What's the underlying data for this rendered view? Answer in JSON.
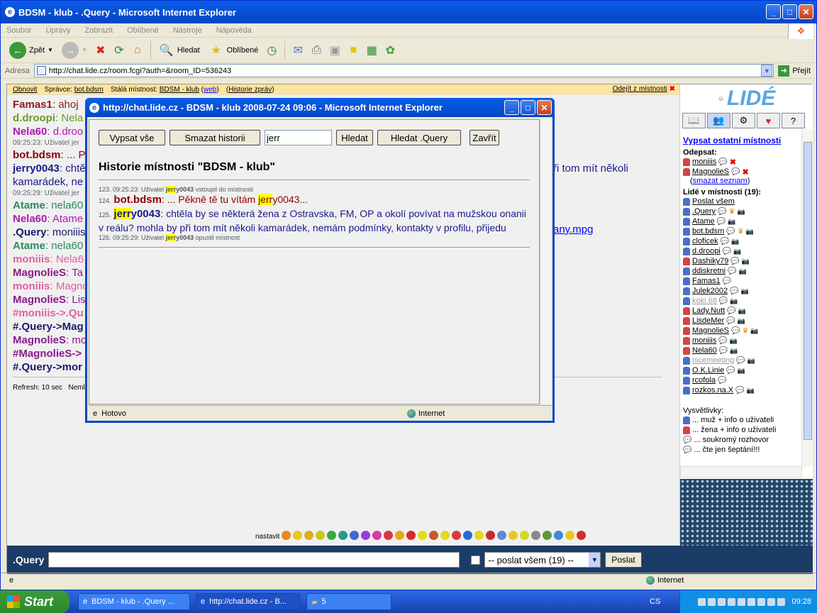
{
  "window": {
    "title": "BDSM - klub - .Query - Microsoft Internet Explorer"
  },
  "menu": [
    "Soubor",
    "Úpravy",
    "Zobrazit",
    "Oblíbené",
    "Nástroje",
    "Nápověda"
  ],
  "toolbar": {
    "back": "Zpět",
    "search": "Hledat",
    "favorites": "Oblíbené"
  },
  "address": {
    "label": "Adresa",
    "url": "http://chat.lide.cz/room.fcgi?auth=&room_ID=536243",
    "go": "Přejít"
  },
  "topline": {
    "refresh": "Obnovit",
    "admin_label": "Správce:",
    "admin": "bot.bdsm",
    "room_label": "Stálá místnost:",
    "room": "BDSM - klub",
    "web": "web",
    "history": "Historie zpráv",
    "leave": "Odejít z místnosti"
  },
  "chat": [
    {
      "nick": "Famas1",
      "color": "#8b1a1a",
      "text": ": ahoj"
    },
    {
      "nick": "d.droopi",
      "color": "#6a9a2a",
      "text": ": Nela"
    },
    {
      "nick": "Nela60",
      "color": "#b01ab0",
      "text": ": d.droo"
    },
    {
      "small": "09:25:23: Uživatel jer"
    },
    {
      "nick": "bot.bdsm",
      "color": "#8b0000",
      "text": ": ... P"
    },
    {
      "nick": "jerry0043",
      "color": "#1a1a8b",
      "text": ": chtě"
    },
    {
      "plain": "kamarádek, ne",
      "color": "#1a1a8b"
    },
    {
      "small": "09:25:29: Uživatel jer"
    },
    {
      "nick": "Atame",
      "color": "#2a8a5a",
      "text": ": nela60"
    },
    {
      "nick": "Nela60",
      "color": "#b01ab0",
      "text": ": Atame"
    },
    {
      "nick": ".Query",
      "color": "#1a1a6b",
      "text": ": moniiis"
    },
    {
      "nick": "Atame",
      "color": "#2a8a5a",
      "text": ": nela60"
    },
    {
      "nick": "moniiis",
      "color": "#e060a0",
      "text": ": Nela6"
    },
    {
      "nick": "MagnolieS",
      "color": "#8a1a8a",
      "text": ": Ta"
    },
    {
      "nick": "moniiis",
      "color": "#e060a0",
      "text": ": Magno"
    },
    {
      "nick": "MagnolieS",
      "color": "#8a1a8a",
      "text": ": Lis"
    },
    {
      "nick": "#moniiis->.Qu",
      "color": "#e060a0",
      "text": ""
    },
    {
      "nick": "#.Query->Mag",
      "color": "#1a1a6b",
      "text": ""
    },
    {
      "nick": "MagnolieS",
      "color": "#8a1a8a",
      "text": ": mo"
    },
    {
      "nick": "#MagnolieS->",
      "color": "#8a1a8a",
      "text": ""
    },
    {
      "nick": "#.Query->mor",
      "color": "#1a1a6b",
      "text": ""
    }
  ],
  "chat_right": {
    "line1": "ři tom mít několi",
    "link": "any.mpg"
  },
  "refresh_text": "Refresh: 10 sec",
  "refresh_suffix": "Neml",
  "smiley_label": "nastavit",
  "side": {
    "list_rooms": "Vypsat ostatní místnosti",
    "unsubscribe_label": "Odepsat:",
    "unsub": [
      "moniiis",
      "MagnolieS"
    ],
    "clear_list": "smazat seznam",
    "in_room": "Lidé v místnosti (19):",
    "send_all": "Poslat všem",
    "users": [
      {
        "n": ".Query",
        "g": "m"
      },
      {
        "n": "Atame",
        "g": "m"
      },
      {
        "n": "bot.bdsm",
        "g": "m"
      },
      {
        "n": "cloficek",
        "g": "m"
      },
      {
        "n": "d.droopi",
        "g": "m"
      },
      {
        "n": "Dashiky79",
        "g": "f"
      },
      {
        "n": "ddiskretni",
        "g": "m"
      },
      {
        "n": "Famas1",
        "g": "m"
      },
      {
        "n": "Julek2002",
        "g": "m"
      },
      {
        "n": "koki.68",
        "g": "m"
      },
      {
        "n": "Lady.Nutt",
        "g": "f"
      },
      {
        "n": "LisdeMer",
        "g": "f"
      },
      {
        "n": "MagnolieS",
        "g": "f"
      },
      {
        "n": "moniiis",
        "g": "f"
      },
      {
        "n": "Nela60",
        "g": "f"
      },
      {
        "n": "nicemeeting",
        "g": "m"
      },
      {
        "n": "O.K.Linie",
        "g": "m"
      },
      {
        "n": "rcofola",
        "g": "m"
      },
      {
        "n": "rozkos.na.X",
        "g": "m"
      }
    ],
    "legend_title": "Vysvětlivky:",
    "legend": [
      "... muž + info o uživateli",
      "... žena + info o uživateli",
      "... soukromý rozhovor",
      "... čte jen šeptání!!!"
    ]
  },
  "input": {
    "nick": ".Query",
    "send_select": "-- poslat všem (19) --",
    "send": "Poslat"
  },
  "status": {
    "text": "",
    "zone": "Internet"
  },
  "popup": {
    "title": "http://chat.lide.cz - BDSM - klub 2008-07-24 09:06 - Microsoft Internet Explorer",
    "btn_all": "Vypsat vše",
    "btn_clear": "Smazat historii",
    "search_value": "jerr",
    "btn_search": "Hledat",
    "btn_search_query": "Hledat .Query",
    "btn_close": "Zavřít",
    "heading": "Historie místnosti \"BDSM - klub\"",
    "l123_pre": "123. 09:25:23: Uživatel ",
    "l123_hl": "jerr",
    "l123_nick": "y0043",
    "l123_post": " vstoupil do místnosti",
    "l124_num": "124.",
    "l124_nick": "bot.bdsm",
    "l124_mid": ": ... Pěkně tě tu vítám ",
    "l124_hl": "jerr",
    "l124_post": "y0043...",
    "l125_num": "125.",
    "l125_hl": "jerr",
    "l125_nick": "y0043",
    "l125_text": ": chtěla by se některá žena z Ostravska, FM, OP a okolí povívat na mužskou onanii v reálu? mohla by při tom mít několi kamarádek, nemám podmínky, kontakty v profilu, přijedu",
    "l126_pre": "126. 09:25:29: Uživatel ",
    "l126_hl": "jerr",
    "l126_nick": "y0043",
    "l126_post": " opustil místnost",
    "status": "Hotovo",
    "zone": "Internet"
  },
  "taskbar": {
    "start": "Start",
    "tasks": [
      "BDSM - klub - .Query ...",
      "http://chat.lide.cz - B...",
      "5"
    ],
    "lang": "CS",
    "time": "09:28"
  }
}
